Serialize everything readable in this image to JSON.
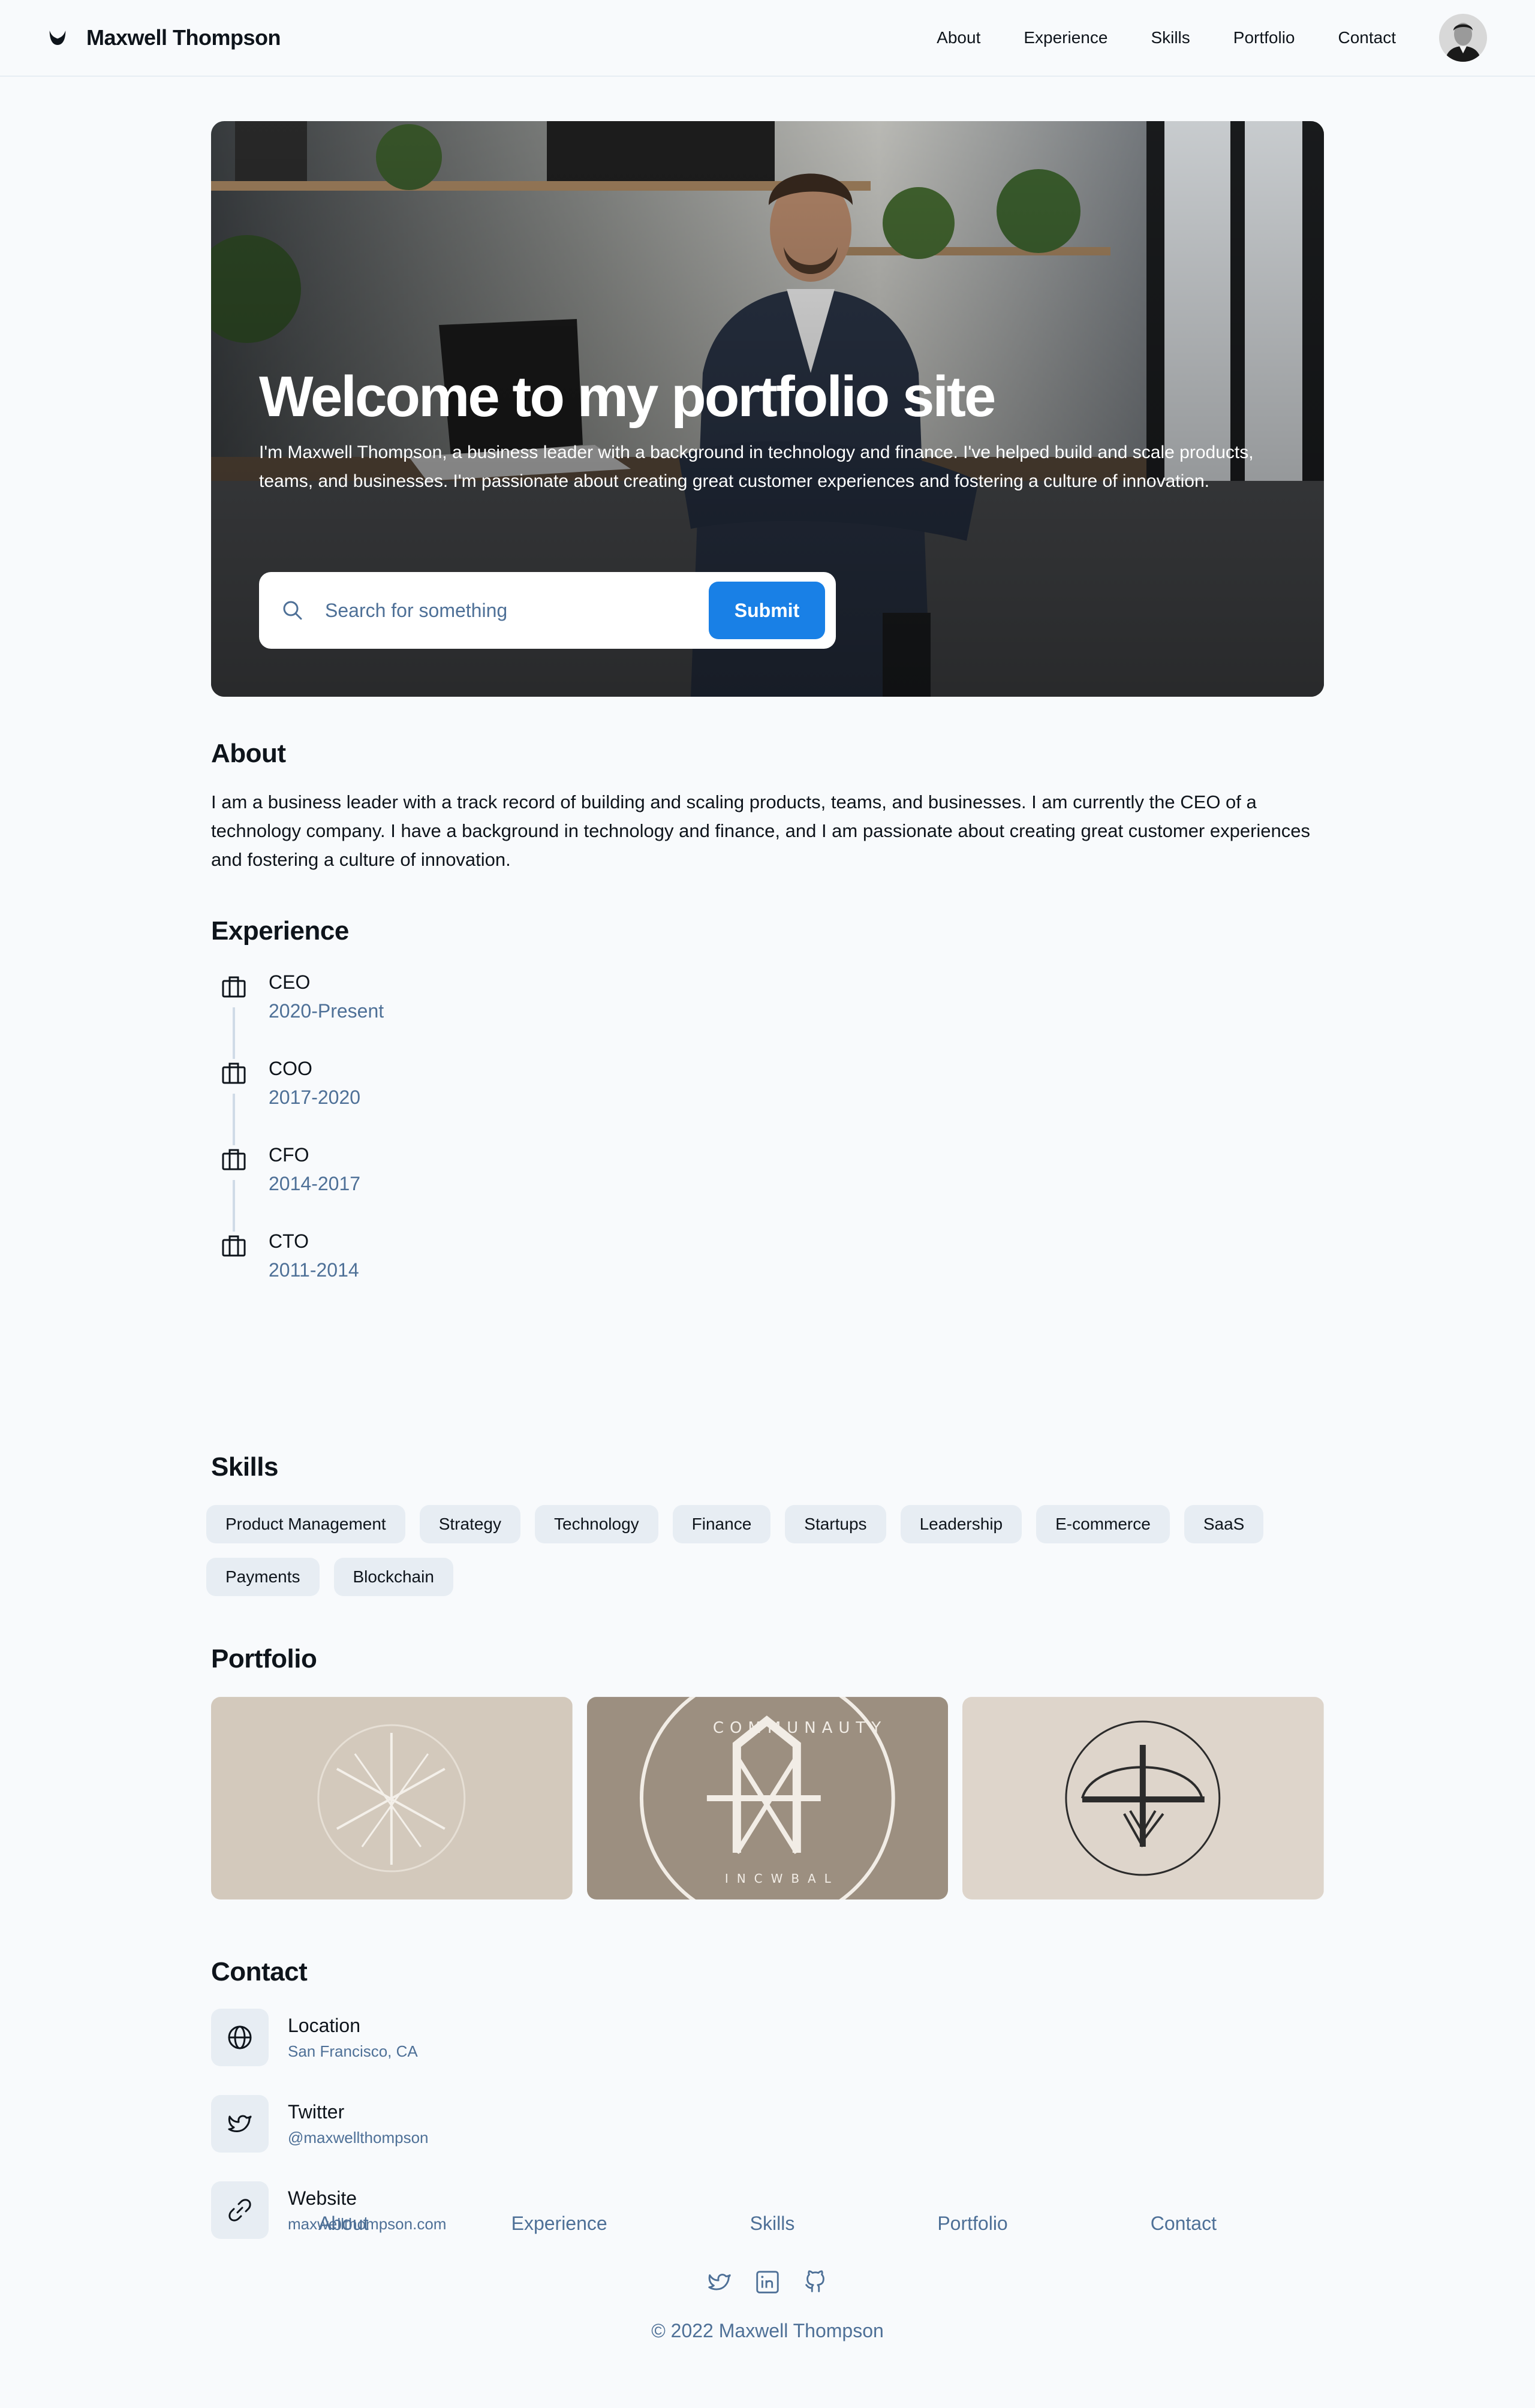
{
  "header": {
    "brand": "Maxwell Thompson",
    "nav": [
      "About",
      "Experience",
      "Skills",
      "Portfolio",
      "Contact"
    ]
  },
  "hero": {
    "title": "Welcome to my portfolio site",
    "subtitle": "I'm Maxwell Thompson, a business leader with a background in technology and finance. I've helped build and scale products, teams, and businesses. I'm passionate about creating great customer experiences and fostering a culture of innovation.",
    "search_placeholder": "Search for something",
    "submit_label": "Submit"
  },
  "about": {
    "title": "About",
    "text": "I am a business leader with a track record of building and scaling products, teams, and businesses. I am currently the CEO of a technology company. I have a background in technology and finance, and I am passionate about creating great customer experiences and fostering a culture of innovation."
  },
  "experience": {
    "title": "Experience",
    "items": [
      {
        "role": "CEO",
        "dates": "2020-Present"
      },
      {
        "role": "COO",
        "dates": "2017-2020"
      },
      {
        "role": "CFO",
        "dates": "2014-2017"
      },
      {
        "role": "CTO",
        "dates": "2011-2014"
      }
    ]
  },
  "skills": {
    "title": "Skills",
    "items": [
      "Product Management",
      "Strategy",
      "Technology",
      "Finance",
      "Startups",
      "Leadership",
      "E-commerce",
      "SaaS",
      "Payments",
      "Blockchain"
    ]
  },
  "portfolio": {
    "title": "Portfolio",
    "tile_text": [
      "COMMUNAUTY",
      "INCWBAL"
    ]
  },
  "contact": {
    "title": "Contact",
    "items": [
      {
        "label": "Location",
        "value": "San Francisco, CA",
        "icon": "globe-icon"
      },
      {
        "label": "Twitter",
        "value": "@maxwellthompson",
        "icon": "twitter-icon"
      },
      {
        "label": "Website",
        "value": "maxwellthompson.com",
        "icon": "link-icon"
      }
    ]
  },
  "footer": {
    "nav": [
      "About",
      "Experience",
      "Skills",
      "Portfolio",
      "Contact"
    ],
    "social_icons": [
      "twitter-icon",
      "linkedin-icon",
      "github-icon"
    ],
    "copyright": "© 2022 Maxwell Thompson"
  },
  "colors": {
    "accent": "#1980e6",
    "muted_text": "#4e7097",
    "chip_bg": "#e7edf3",
    "page_bg": "#f8fafc"
  }
}
